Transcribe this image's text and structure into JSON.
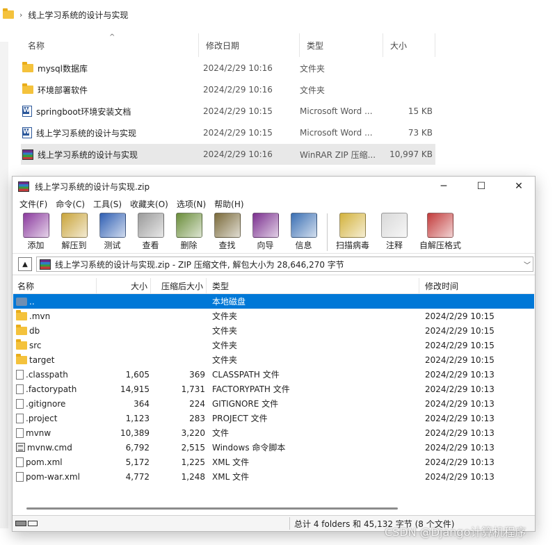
{
  "explorer": {
    "breadcrumb": "线上学习系统的设计与实现",
    "columns": {
      "name": "名称",
      "date": "修改日期",
      "type": "类型",
      "size": "大小"
    },
    "rows": [
      {
        "name": "mysql数据库",
        "date": "2024/2/29 10:16",
        "type": "文件夹",
        "size": "",
        "icon": "folder-icon"
      },
      {
        "name": "环境部署软件",
        "date": "2024/2/29 10:16",
        "type": "文件夹",
        "size": "",
        "icon": "folder-icon"
      },
      {
        "name": "springboot环境安装文档",
        "date": "2024/2/29 10:15",
        "type": "Microsoft Word ...",
        "size": "15 KB",
        "icon": "word-doc-icon"
      },
      {
        "name": "线上学习系统的设计与实现",
        "date": "2024/2/29 10:15",
        "type": "Microsoft Word ...",
        "size": "73 KB",
        "icon": "word-doc-icon"
      },
      {
        "name": "线上学习系统的设计与实现",
        "date": "2024/2/29 10:16",
        "type": "WinRAR ZIP 压缩...",
        "size": "10,997 KB",
        "icon": "winrar-archive-icon",
        "selected": true
      }
    ]
  },
  "winrar": {
    "title": "线上学习系统的设计与实现.zip",
    "menu": [
      "文件(F)",
      "命令(C)",
      "工具(S)",
      "收藏夹(O)",
      "选项(N)",
      "帮助(H)"
    ],
    "toolbar": [
      {
        "label": "添加",
        "icon": "add-archive-icon",
        "color": "#8b3a9e"
      },
      {
        "label": "解压到",
        "icon": "extract-to-icon",
        "color": "#c9a43a"
      },
      {
        "label": "测试",
        "icon": "test-icon",
        "color": "#2f5fb3"
      },
      {
        "label": "查看",
        "icon": "view-icon",
        "color": "#9a9a9a"
      },
      {
        "label": "删除",
        "icon": "delete-icon",
        "color": "#6a8d3a"
      },
      {
        "label": "查找",
        "icon": "find-icon",
        "color": "#7a6a3a"
      },
      {
        "label": "向导",
        "icon": "wizard-icon",
        "color": "#7b2f8f"
      },
      {
        "label": "信息",
        "icon": "info-icon",
        "color": "#3a6fb3"
      }
    ],
    "toolbar2": [
      {
        "label": "扫描病毒",
        "icon": "virus-scan-icon",
        "color": "#d3b23c"
      },
      {
        "label": "注释",
        "icon": "comment-icon",
        "color": "#d9d9d9"
      },
      {
        "label": "自解压格式",
        "icon": "sfx-icon",
        "color": "#c23b3b"
      }
    ],
    "address": "线上学习系统的设计与实现.zip - ZIP 压缩文件, 解包大小为 28,646,270 字节",
    "columns": {
      "name": "名称",
      "size": "大小",
      "packed": "压缩后大小",
      "type": "类型",
      "modified": "修改时间"
    },
    "rows": [
      {
        "name": "..",
        "size": "",
        "packed": "",
        "type": "本地磁盘",
        "modified": "",
        "icon": "drive-icon",
        "selected": true
      },
      {
        "name": ".mvn",
        "size": "",
        "packed": "",
        "type": "文件夹",
        "modified": "2024/2/29 10:15",
        "icon": "folder-icon"
      },
      {
        "name": "db",
        "size": "",
        "packed": "",
        "type": "文件夹",
        "modified": "2024/2/29 10:15",
        "icon": "folder-icon"
      },
      {
        "name": "src",
        "size": "",
        "packed": "",
        "type": "文件夹",
        "modified": "2024/2/29 10:15",
        "icon": "folder-icon"
      },
      {
        "name": "target",
        "size": "",
        "packed": "",
        "type": "文件夹",
        "modified": "2024/2/29 10:15",
        "icon": "folder-icon"
      },
      {
        "name": ".classpath",
        "size": "1,605",
        "packed": "369",
        "type": "CLASSPATH 文件",
        "modified": "2024/2/29 10:13",
        "icon": "file-icon"
      },
      {
        "name": ".factorypath",
        "size": "14,915",
        "packed": "1,731",
        "type": "FACTORYPATH 文件",
        "modified": "2024/2/29 10:13",
        "icon": "file-icon"
      },
      {
        "name": ".gitignore",
        "size": "364",
        "packed": "224",
        "type": "GITIGNORE 文件",
        "modified": "2024/2/29 10:13",
        "icon": "file-icon"
      },
      {
        "name": ".project",
        "size": "1,123",
        "packed": "283",
        "type": "PROJECT 文件",
        "modified": "2024/2/29 10:13",
        "icon": "file-icon"
      },
      {
        "name": "mvnw",
        "size": "10,389",
        "packed": "3,220",
        "type": "文件",
        "modified": "2024/2/29 10:13",
        "icon": "file-icon"
      },
      {
        "name": "mvnw.cmd",
        "size": "6,792",
        "packed": "2,515",
        "type": "Windows 命令脚本",
        "modified": "2024/2/29 10:13",
        "icon": "cmd-script-icon"
      },
      {
        "name": "pom.xml",
        "size": "5,172",
        "packed": "1,225",
        "type": "XML 文件",
        "modified": "2024/2/29 10:13",
        "icon": "file-icon"
      },
      {
        "name": "pom-war.xml",
        "size": "4,772",
        "packed": "1,248",
        "type": "XML 文件",
        "modified": "2024/2/29 10:13",
        "icon": "file-icon"
      }
    ],
    "status": "总计 4 folders 和 45,132 字节 (8 个文件)"
  },
  "watermark": "CSDN @Django计算机程序"
}
